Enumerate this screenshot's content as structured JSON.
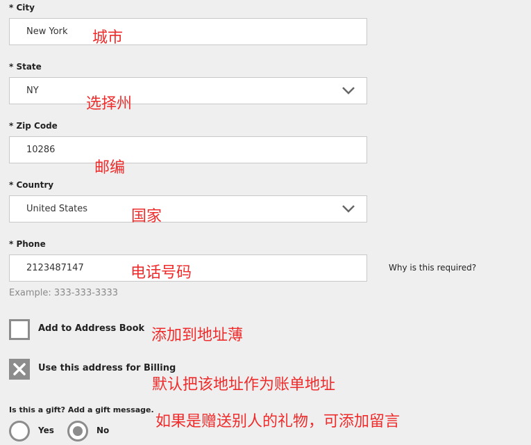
{
  "form": {
    "city": {
      "label": "* City",
      "value": "New York"
    },
    "state": {
      "label": "* State",
      "value": "NY",
      "icon": "chevron-down-icon"
    },
    "zip": {
      "label": "* Zip Code",
      "value": "10286"
    },
    "country": {
      "label": "* Country",
      "value": "United States",
      "icon": "chevron-down-icon"
    },
    "phone": {
      "label": "* Phone",
      "value": "2123487147",
      "example": "Example: 333-333-3333",
      "why_link": "Why is this required?"
    },
    "address_book": {
      "label": "Add to Address Book",
      "checked": false
    },
    "billing": {
      "label": "Use this address for Billing",
      "checked": true
    },
    "gift": {
      "question": "Is this a gift? Add a gift message.",
      "yes_label": "Yes",
      "no_label": "No",
      "selected": "No"
    }
  },
  "annotations": {
    "city": "城市",
    "state": "选择州",
    "zip": "邮编",
    "country": "国家",
    "phone": "电话号码",
    "address_book": "添加到地址薄",
    "billing": "默认把该地址作为账单地址",
    "gift": "如果是赠送别人的礼物，可添加留言"
  },
  "colors": {
    "background": "#efefef",
    "annotation": "#ee2c2c",
    "control_gray": "#8c8c8c"
  }
}
